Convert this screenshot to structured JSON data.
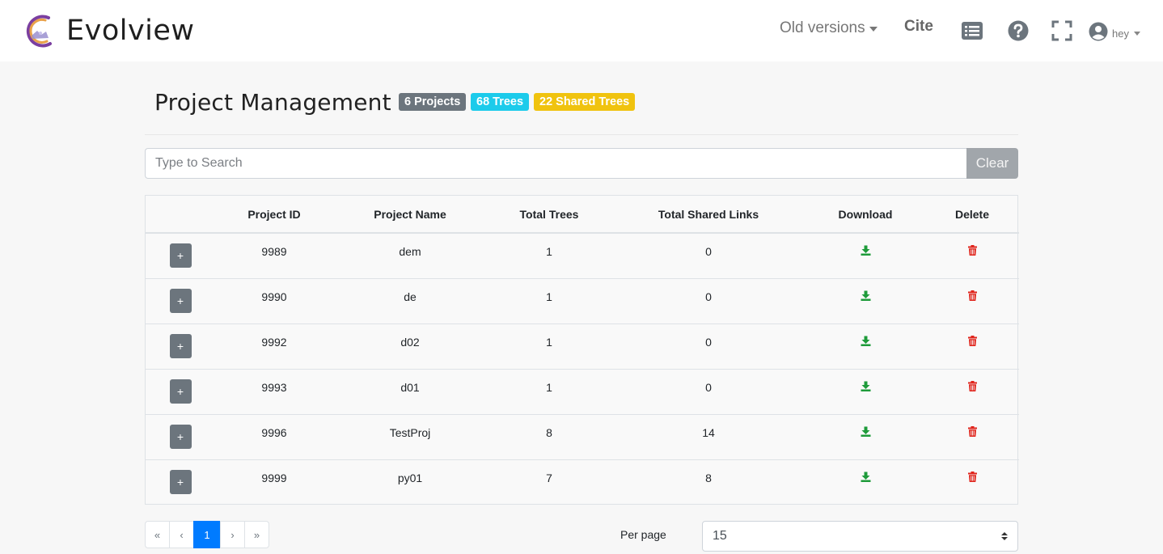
{
  "app": {
    "name": "Evolview"
  },
  "nav": {
    "old_versions": "Old versions",
    "cite": "Cite",
    "user": "hey",
    "icons": [
      "list-icon",
      "help-icon",
      "fullscreen-icon",
      "user-circle-icon"
    ]
  },
  "header": {
    "title": "Project Management",
    "badges": {
      "projects": "6 Projects",
      "trees": "68 Trees",
      "shared": "22 Shared Trees"
    },
    "badge_colors": {
      "projects": "#6c757d",
      "trees": "#1ccbeb",
      "shared": "#f0c30f"
    }
  },
  "search": {
    "placeholder": "Type to Search",
    "value": "",
    "clear_label": "Clear"
  },
  "table": {
    "columns": [
      "",
      "Project ID",
      "Project Name",
      "Total Trees",
      "Total Shared Links",
      "Download",
      "Delete"
    ],
    "rows": [
      {
        "expand": "+",
        "id": "9989",
        "name": "dem",
        "trees": "1",
        "links": "0"
      },
      {
        "expand": "+",
        "id": "9990",
        "name": "de",
        "trees": "1",
        "links": "0"
      },
      {
        "expand": "+",
        "id": "9992",
        "name": "d02",
        "trees": "1",
        "links": "0"
      },
      {
        "expand": "+",
        "id": "9993",
        "name": "d01",
        "trees": "1",
        "links": "0"
      },
      {
        "expand": "+",
        "id": "9996",
        "name": "TestProj",
        "trees": "8",
        "links": "14"
      },
      {
        "expand": "+",
        "id": "9999",
        "name": "py01",
        "trees": "7",
        "links": "8"
      }
    ],
    "download_color": "#1e9b3a",
    "delete_color": "#e0241b"
  },
  "pagination": {
    "first": "«",
    "prev": "‹",
    "current": "1",
    "next": "›",
    "last": "»",
    "per_page_label": "Per page",
    "per_page_value": "15"
  }
}
